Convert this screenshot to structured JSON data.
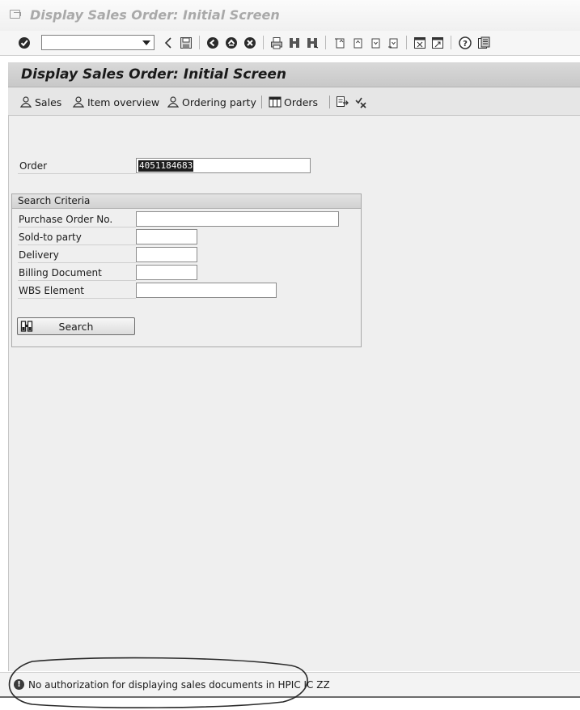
{
  "window": {
    "title": "Display Sales Order: Initial Screen"
  },
  "system_toolbar": {
    "command_field_value": "",
    "icons": [
      "enter-icon",
      "back-icon",
      "save-icon",
      "back-nav-icon",
      "exit-icon",
      "cancel-icon",
      "print-icon",
      "find-icon",
      "find-next-icon",
      "first-page-icon",
      "previous-page-icon",
      "next-page-icon",
      "last-page-icon",
      "create-session-icon",
      "shortcut-icon",
      "help-icon",
      "layout-menu-icon"
    ]
  },
  "screen": {
    "title": "Display Sales Order: Initial Screen",
    "app_toolbar": {
      "sales": "Sales",
      "item_overview": "Item overview",
      "ordering_party": "Ordering party",
      "orders": "Orders"
    },
    "order": {
      "label": "Order",
      "value": "4051184683"
    },
    "search_criteria": {
      "title": "Search Criteria",
      "fields": [
        {
          "label": "Purchase Order No.",
          "value": ""
        },
        {
          "label": "Sold-to party",
          "value": ""
        },
        {
          "label": "Delivery",
          "value": ""
        },
        {
          "label": "Billing Document",
          "value": ""
        },
        {
          "label": "WBS Element",
          "value": ""
        }
      ],
      "search_button": "Search"
    }
  },
  "status_bar": {
    "type": "warning",
    "message": "No authorization for displaying sales documents in HPIC IC ZZ"
  }
}
